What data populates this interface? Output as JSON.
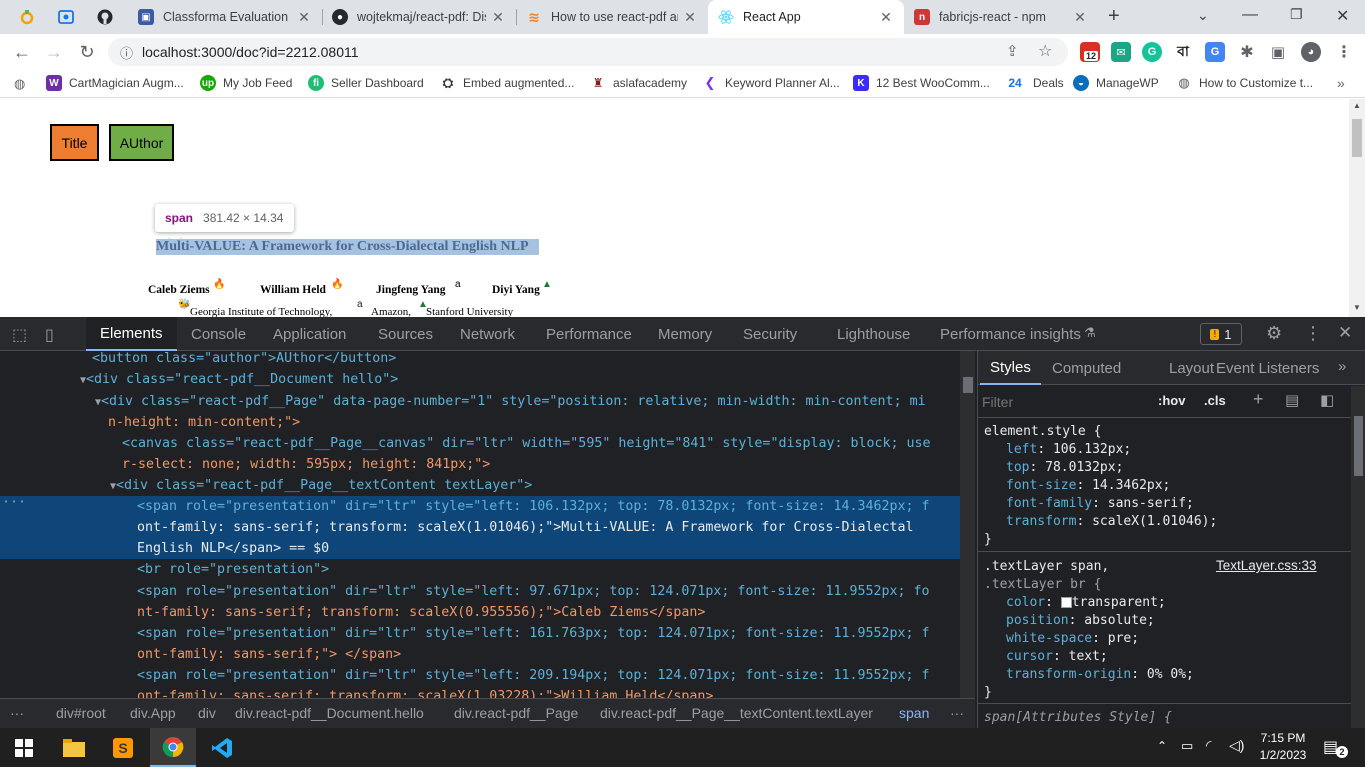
{
  "browser": {
    "tabs": [
      {
        "title": "Classforma Evaluation",
        "icon": "classforma-icon",
        "color": "#3b5ba5"
      },
      {
        "title": "wojtekmaj/react-pdf: Dis",
        "icon": "github-icon",
        "color": "#24292f"
      },
      {
        "title": "How to use react-pdf an",
        "icon": "stackoverflow-icon",
        "color": "#f48024"
      },
      {
        "title": "React App",
        "icon": "react-icon",
        "color": "#61dafb"
      },
      {
        "title": "fabricjs-react - npm",
        "icon": "npm-icon",
        "color": "#cb3837"
      }
    ],
    "url": "localhost:3000/doc?id=2212.08011",
    "extension_badge": "12",
    "extension_bengali": "বা",
    "bookmarks": [
      {
        "label": "CartMagician Augm...",
        "color": "#6f2da8"
      },
      {
        "label": "My Job Feed",
        "color": "#14a800"
      },
      {
        "label": "Seller Dashboard",
        "color": "#1dbf73"
      },
      {
        "label": "Embed augmented...",
        "color": "#333333"
      },
      {
        "label": "aslafacademy",
        "color": "#8b1a1a"
      },
      {
        "label": "Keyword Planner Al...",
        "color": "#7b2ff7"
      },
      {
        "label": "12 Best WooComm...",
        "color": "#3d2aff"
      },
      {
        "label": "Deals",
        "color": "#1a73e8",
        "prefix": "24"
      },
      {
        "label": "ManageWP",
        "color": "#0a6ebd"
      },
      {
        "label": "How to Customize t...",
        "color": "#555555"
      }
    ]
  },
  "page": {
    "buttons": {
      "title": "Title",
      "author": "AUthor"
    },
    "tooltip": {
      "tag": "span",
      "dims": "381.42 × 14.34"
    },
    "paper_title": "Multi-VALUE: A Framework for Cross-Dialectal English NLP",
    "authors": [
      "Caleb Ziems",
      "William Held",
      "Jingfeng Yang",
      "Diyi Yang"
    ],
    "affiliations": [
      "Georgia Institute of Technology,",
      "Amazon,",
      "Stanford University"
    ],
    "colors": {
      "title_btn": "#ed7d31",
      "author_btn": "#70ad47"
    }
  },
  "devtools": {
    "tabs": [
      "Elements",
      "Console",
      "Application",
      "Sources",
      "Network",
      "Performance",
      "Memory",
      "Security",
      "Lighthouse",
      "Performance insights"
    ],
    "issues_count": "1",
    "styles_tabs": [
      "Styles",
      "Computed",
      "Layout",
      "Event Listeners"
    ],
    "filter_placeholder": "Filter",
    "hov": ":hov",
    "cls": ".cls",
    "element_style": {
      "selector": "element.style {",
      "props": [
        {
          "name": "left",
          "value": "106.132px;"
        },
        {
          "name": "top",
          "value": "78.0132px;"
        },
        {
          "name": "font-size",
          "value": "14.3462px;"
        },
        {
          "name": "font-family",
          "value": "sans-serif;"
        },
        {
          "name": "transform",
          "value": "scaleX(1.01046);"
        }
      ]
    },
    "textlayer_rule": {
      "selector1": ".textLayer span,",
      "selector2": ".textLayer br {",
      "source": "TextLayer.css:33",
      "props": [
        {
          "name": "color",
          "value": "transparent;"
        },
        {
          "name": "position",
          "value": "absolute;"
        },
        {
          "name": "white-space",
          "value": "pre;"
        },
        {
          "name": "cursor",
          "value": "text;"
        },
        {
          "name": "transform-origin",
          "value": "0% 0%;"
        }
      ]
    },
    "next_rule": "span[Attributes Style] {",
    "close_brace": "}",
    "breadcrumbs": [
      "div#root",
      "div.App",
      "div",
      "div.react-pdf__Document.hello",
      "div.react-pdf__Page",
      "div.react-pdf__Page__textContent.textLayer",
      "span"
    ],
    "code_lines": [
      "<button class=\"author\">AUthor</button>",
      "<div class=\"react-pdf__Document hello\">",
      "<div class=\"react-pdf__Page\" data-page-number=\"1\" style=\"position: relative; min-width: min-content; mi",
      "n-height: min-content;\">",
      "<canvas class=\"react-pdf__Page__canvas\" dir=\"ltr\" width=\"595\" height=\"841\" style=\"display: block; use",
      "r-select: none; width: 595px; height: 841px;\">",
      "<div class=\"react-pdf__Page__textContent textLayer\">",
      "<span role=\"presentation\" dir=\"ltr\" style=\"left: 106.132px; top: 78.0132px; font-size: 14.3462px; f",
      "ont-family: sans-serif; transform: scaleX(1.01046);\">Multi-VALUE: A Framework for Cross-Dialectal",
      "English NLP</span> == $0",
      "<br role=\"presentation\">",
      "<span role=\"presentation\" dir=\"ltr\" style=\"left: 97.671px; top: 124.071px; font-size: 11.9552px; fo",
      "nt-family: sans-serif; transform: scaleX(0.955556);\">Caleb Ziems</span>",
      "<span role=\"presentation\" dir=\"ltr\" style=\"left: 161.763px; top: 124.071px; font-size: 11.9552px; f",
      "ont-family: sans-serif;\"> </span>",
      "<span role=\"presentation\" dir=\"ltr\" style=\"left: 209.194px; top: 124.071px; font-size: 11.9552px; f",
      "ont-family: sans-serif; transform: scaleX(1.03228);\">William Held</span>"
    ]
  },
  "taskbar": {
    "time": "7:15 PM",
    "date": "1/2/2023",
    "notifications": "2"
  }
}
